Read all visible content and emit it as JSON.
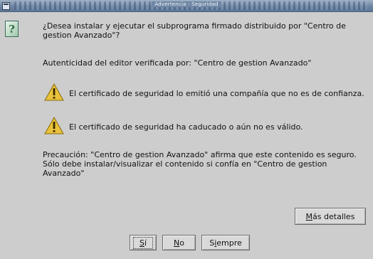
{
  "window": {
    "title": "Advertencia - Seguridad"
  },
  "dialog": {
    "question_line1": "¿Desea instalar y ejecutar el subprograma firmado distribuido por \"Centro de",
    "question_line2": "gestion Avanzado\"?",
    "authenticity": "Autenticidad del editor verificada por: \"Centro de gestion Avanzado\"",
    "warnings": [
      "El certificado de seguridad lo emitió una compañía que no es de confianza.",
      "El certificado de seguridad ha caducado o aún no es válido."
    ],
    "caution_line1": "Precaución: \"Centro de gestion Avanzado\" afirma que este contenido es seguro.",
    "caution_line2": "Sólo debe instalar/visualizar el contenido si confía en \"Centro de gestion",
    "caution_line3": "Avanzado\""
  },
  "buttons": {
    "more_details": {
      "mnemonic": "M",
      "rest": "ás detalles"
    },
    "yes": {
      "mnemonic": "S",
      "rest": "í"
    },
    "no": {
      "mnemonic": "N",
      "rest": "o"
    },
    "always": {
      "first": "S",
      "mnemonic": "i",
      "rest": "empre"
    }
  },
  "icons": {
    "question": "question-icon",
    "warning": "warning-icon"
  },
  "colors": {
    "background": "#cdcdcd",
    "titlebar": "#6e86a4",
    "warning_fill": "#e8c23a"
  }
}
